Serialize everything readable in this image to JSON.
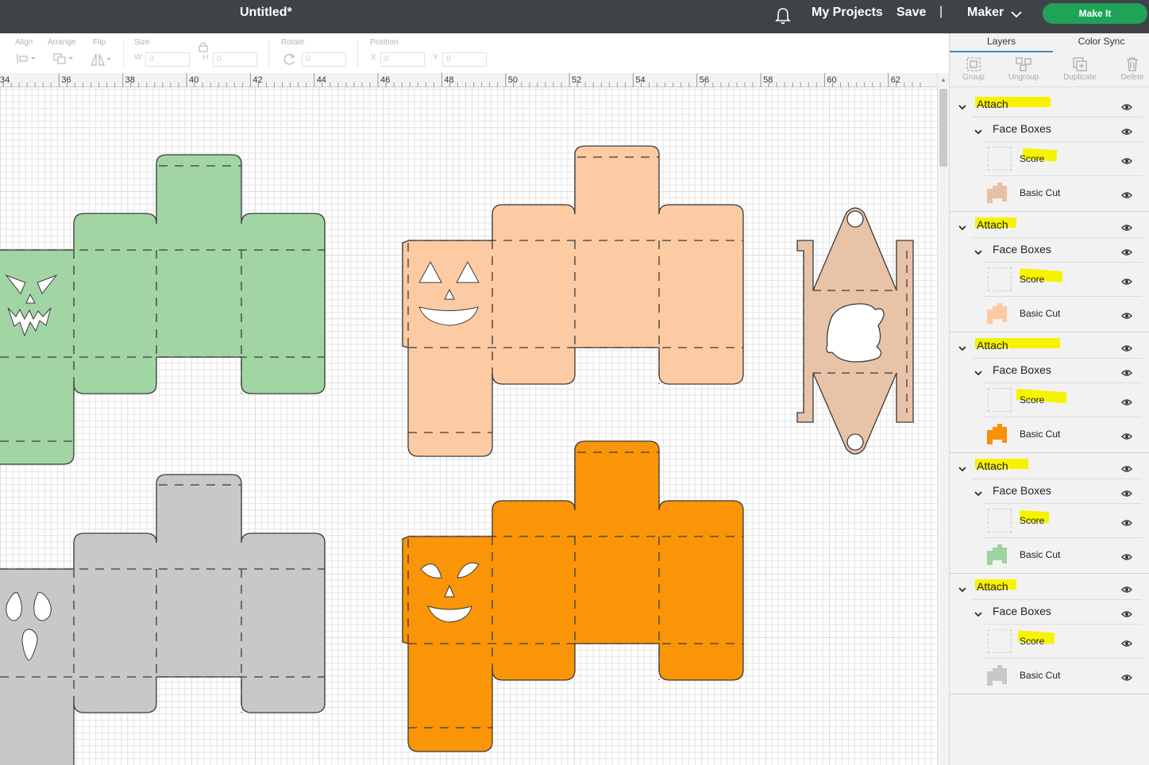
{
  "header": {
    "doc_title": "Untitled*",
    "my_projects": "My Projects",
    "save": "Save",
    "separator": "|",
    "machine": "Maker",
    "make_it": "Make It"
  },
  "toolbar": {
    "align": "Align",
    "arrange": "Arrange",
    "flip": "Flip",
    "size": "Size",
    "w_label": "W",
    "w_value": "0",
    "h_label": "H",
    "h_value": "0",
    "rotate": "Rotate",
    "rotate_value": "0",
    "position": "Position",
    "x_label": "X",
    "x_value": "0",
    "y_label": "Y",
    "y_value": "0"
  },
  "ruler": {
    "ticks": [
      "34",
      "36",
      "38",
      "40",
      "42",
      "44",
      "46",
      "48",
      "50",
      "52",
      "54",
      "56",
      "58",
      "60",
      "62"
    ]
  },
  "panel": {
    "tabs": [
      "Layers",
      "Color Sync"
    ],
    "actions": [
      "Group",
      "Ungroup",
      "Duplicate",
      "Delete"
    ],
    "groups": [
      {
        "label": "Attach",
        "sub": "Face Boxes",
        "score": "Score",
        "cut": "Basic Cut",
        "cut_color": "#e8c1a5"
      },
      {
        "label": "Attach",
        "sub": "Face Boxes",
        "score": "Score",
        "cut": "Basic Cut",
        "cut_color": "#fcc9a2"
      },
      {
        "label": "Attach",
        "sub": "Face Boxes",
        "score": "Score",
        "cut": "Basic Cut",
        "cut_color": "#f7900a"
      },
      {
        "label": "Attach",
        "sub": "Face Boxes",
        "score": "Score",
        "cut": "Basic Cut",
        "cut_color": "#9fd3a0"
      },
      {
        "label": "Attach",
        "sub": "Face Boxes",
        "score": "Score",
        "cut": "Basic Cut",
        "cut_color": "#c8c8c8"
      }
    ]
  },
  "colors": {
    "green": "#a2d5a4",
    "peach": "#fdcba3",
    "orange": "#f99506",
    "gray": "#c8c8c8",
    "tan": "#e8c3a8",
    "highlight": "#f7f300",
    "make_it": "#1fa357"
  }
}
